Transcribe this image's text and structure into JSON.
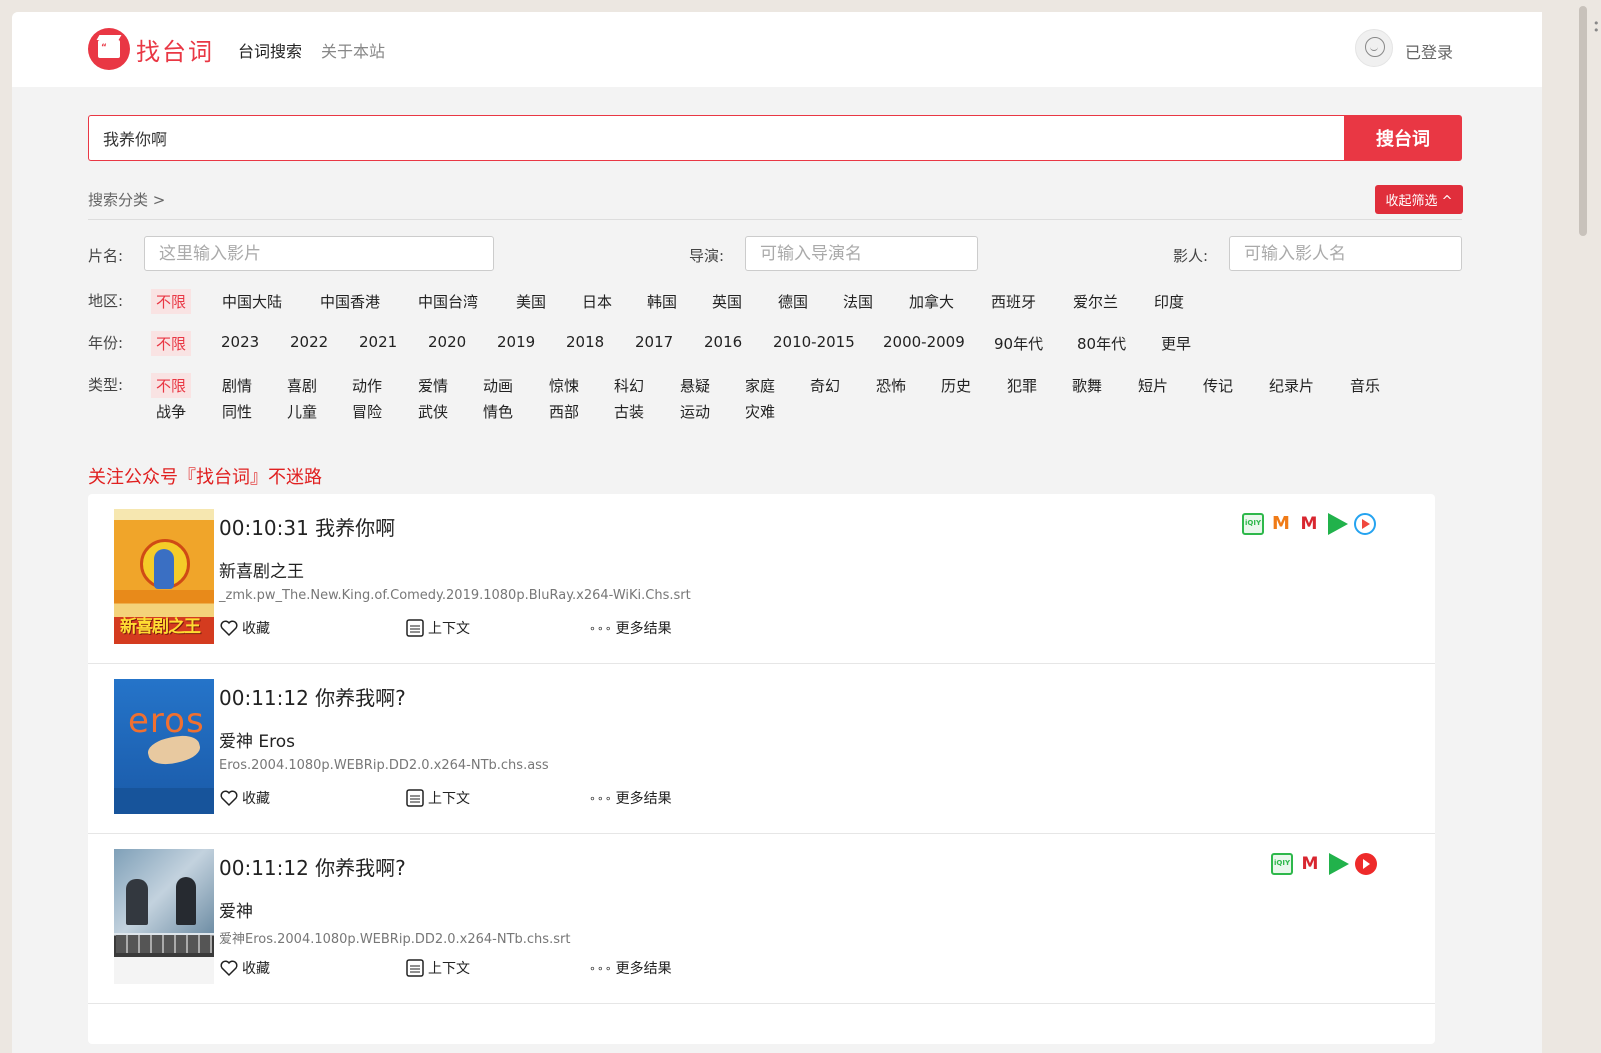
{
  "header": {
    "brand": "找台词",
    "nav": [
      "台词搜索",
      "关于本站"
    ],
    "login": "已登录"
  },
  "search": {
    "query": "我养你啊",
    "button": "搜台词"
  },
  "filters": {
    "title": "搜索分类 >",
    "collapse": "收起筛选 ^",
    "fields": {
      "title_label": "片名:",
      "title_placeholder": "这里输入影片",
      "director_label": "导演:",
      "director_placeholder": "可输入导演名",
      "actor_label": "影人:",
      "actor_placeholder": "可输入影人名"
    },
    "region_label": "地区:",
    "regions": [
      "不限",
      "中国大陆",
      "中国香港",
      "中国台湾",
      "美国",
      "日本",
      "韩国",
      "英国",
      "德国",
      "法国",
      "加拿大",
      "西班牙",
      "爱尔兰",
      "印度"
    ],
    "year_label": "年份:",
    "years": [
      "不限",
      "2023",
      "2022",
      "2021",
      "2020",
      "2019",
      "2018",
      "2017",
      "2016",
      "2010-2015",
      "2000-2009",
      "90年代",
      "80年代",
      "更早"
    ],
    "genre_label": "类型:",
    "genres_row1": [
      "不限",
      "剧情",
      "喜剧",
      "动作",
      "爱情",
      "动画",
      "惊悚",
      "科幻",
      "悬疑",
      "家庭",
      "奇幻",
      "恐怖",
      "历史",
      "犯罪",
      "歌舞",
      "短片",
      "传记",
      "纪录片",
      "音乐"
    ],
    "genres_row2": [
      "战争",
      "同性",
      "儿童",
      "冒险",
      "武侠",
      "情色",
      "西部",
      "古装",
      "运动",
      "灾难"
    ]
  },
  "notice": "关注公众号『找台词』不迷路",
  "actions": {
    "favorite": "收藏",
    "context": "上下文",
    "more": "更多结果"
  },
  "results": [
    {
      "time_title": "00:10:31 我养你啊",
      "movie": "新喜剧之王",
      "file": "_zmk.pw_The.New.King.of.Comedy.2019.1080p.BluRay.x264-WiKi.Chs.srt",
      "poster_text": "新喜剧之王",
      "platforms": [
        "iqiyi-icon",
        "mango-tv-icon",
        "migu-icon",
        "tencent-video-icon",
        "youku-icon"
      ]
    },
    {
      "time_title": "00:11:12 你养我啊?",
      "movie": "爱神 Eros",
      "file": "Eros.2004.1080p.WEBRip.DD2.0.x264-NTb.chs.ass",
      "poster_text": "eros",
      "platforms": []
    },
    {
      "time_title": "00:11:12 你养我啊?",
      "movie": "爱神",
      "file": "爱神Eros.2004.1080p.WEBRip.DD2.0.x264-NTb.chs.srt",
      "poster_text": "",
      "platforms": [
        "iqiyi-icon",
        "migu-icon",
        "tencent-video-icon",
        "red-play-icon"
      ]
    }
  ],
  "colors": {
    "accent": "#e93744",
    "notice": "#e02020"
  }
}
